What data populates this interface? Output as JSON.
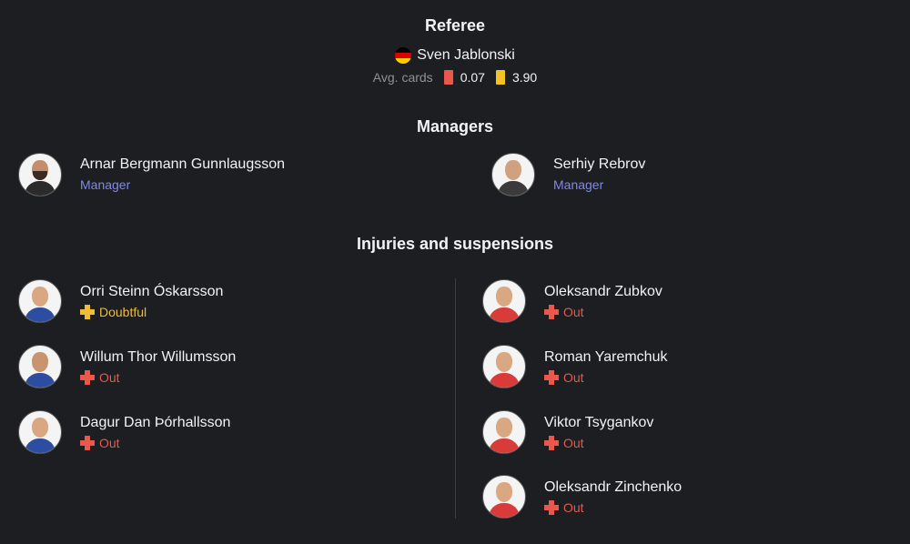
{
  "referee": {
    "title": "Referee",
    "name": "Sven Jablonski",
    "flag": "germany-flag-icon",
    "avg_label": "Avg. cards",
    "red_avg": "0.07",
    "yellow_avg": "3.90",
    "colors": {
      "red_card": "#e9584a",
      "yellow_card": "#f3c323"
    }
  },
  "managers": {
    "title": "Managers",
    "home": {
      "name": "Arnar Bergmann Gunnlaugsson",
      "role": "Manager"
    },
    "away": {
      "name": "Serhiy Rebrov",
      "role": "Manager"
    }
  },
  "injuries": {
    "title": "Injuries and suspensions",
    "home": [
      {
        "name": "Orri Steinn Óskarsson",
        "status": "Doubtful"
      },
      {
        "name": "Willum Thor Willumsson",
        "status": "Out"
      },
      {
        "name": "Dagur Dan Þórhallsson",
        "status": "Out"
      }
    ],
    "away": [
      {
        "name": "Oleksandr Zubkov",
        "status": "Out"
      },
      {
        "name": "Roman Yaremchuk",
        "status": "Out"
      },
      {
        "name": "Viktor Tsygankov",
        "status": "Out"
      },
      {
        "name": "Oleksandr Zinchenko",
        "status": "Out"
      }
    ]
  },
  "colors": {
    "background": "#1d1e21",
    "manager_role": "#7e8aea",
    "doubtful": "#efbd33",
    "out": "#e9584a"
  }
}
